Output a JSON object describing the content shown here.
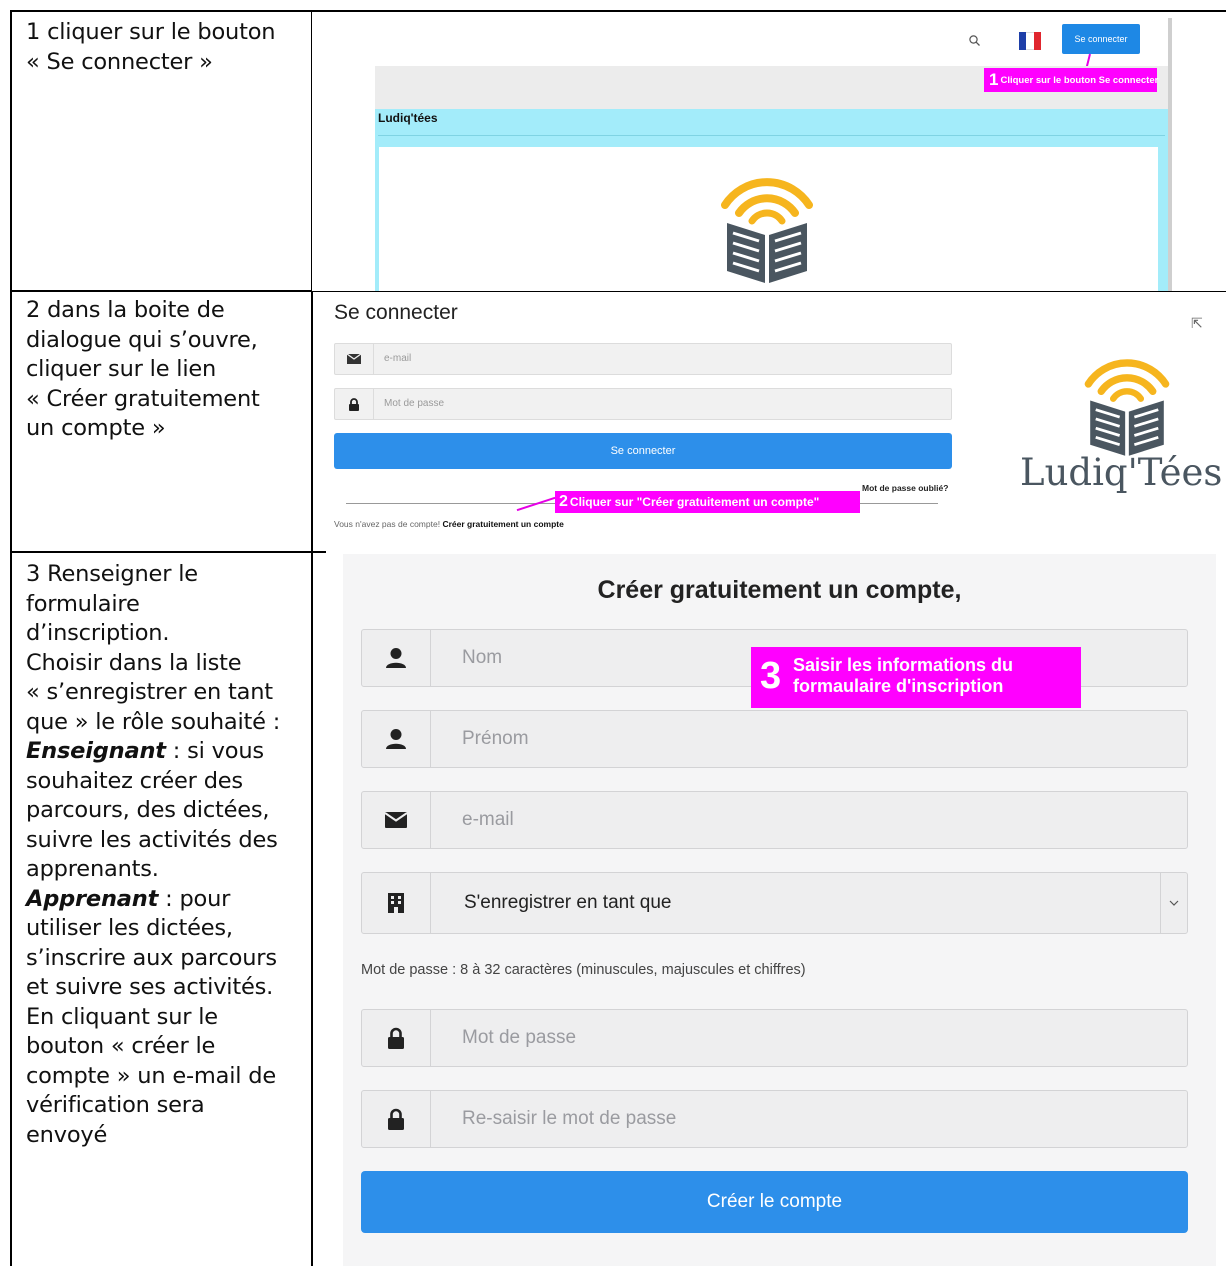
{
  "rows": [
    {
      "step": "1",
      "instruction_lines": [
        "1 cliquer sur le bouton",
        "« Se connecter »"
      ]
    },
    {
      "step": "2",
      "instruction_lines": [
        "2 dans la boite de",
        "dialogue qui s’ouvre,",
        "cliquer sur le lien",
        "« Créer gratuitement",
        "un compte »"
      ]
    },
    {
      "step": "3",
      "instruction_lines_a": [
        "3 Renseigner le",
        "formulaire",
        "d’inscription.",
        "Choisir dans la liste",
        "« s’enregistrer en tant",
        "que » le rôle souhaité :"
      ],
      "role1_name": "Enseignant",
      "role1_desc_lines": [
        " : si vous",
        "souhaitez créer des",
        "parcours, des dictées,",
        "suivre les activités des",
        "apprenants."
      ],
      "role2_name": "Apprenant",
      "role2_desc_lines": [
        " : pour",
        "utiliser les dictées,",
        "s’inscrire aux parcours",
        "et suivre ses activités.",
        "En cliquant sur le",
        "bouton « créer le",
        "compte » un e-mail de",
        "vérification sera",
        "envoyé"
      ]
    }
  ],
  "screenshot1": {
    "login_button": "Se connecter",
    "annotation_number": "1",
    "annotation_text": "Cliquer sur le bouton Se connecter",
    "panel_title": "Ludiq'tées",
    "icons": [
      "search-icon",
      "french-flag-icon"
    ]
  },
  "screenshot2": {
    "title": "Se connecter",
    "email_placeholder": "e-mail",
    "password_placeholder": "Mot de passe",
    "login_button": "Se connecter",
    "forgot_password": "Mot de passe oublié?",
    "annotation_number": "2",
    "annotation_text": "Cliquer sur \"Créer gratuitement un compte\"",
    "no_account_text": "Vous n'avez pas de compte!",
    "create_account_link": "Créer gratuitement un compte",
    "logo_text": "Ludiq'Tées"
  },
  "screenshot3": {
    "title": "Créer gratuitement un compte,",
    "fields": [
      {
        "placeholder": "Nom",
        "icon": "user-icon"
      },
      {
        "placeholder": "Prénom",
        "icon": "user-icon"
      },
      {
        "placeholder": "e-mail",
        "icon": "envelope-icon"
      }
    ],
    "select_value": "S'enregistrer en tant que",
    "password_hint": "Mot de passe : 8 à 32 caractères (minuscules, majuscules et chiffres)",
    "password_placeholder": "Mot de passe",
    "password_confirm_placeholder": "Re-saisir le mot de passe",
    "annotation_number": "3",
    "annotation_line1": "Saisir les informations du",
    "annotation_line2": "formaulaire d'inscription",
    "submit_button": "Créer le compte"
  },
  "colors": {
    "primary_blue": "#2d8fea",
    "annotation_magenta": "#ff00ff",
    "panel_cyan": "#a3ecfa",
    "logo_orange": "#f6b51e",
    "logo_gray": "#4a5660"
  }
}
